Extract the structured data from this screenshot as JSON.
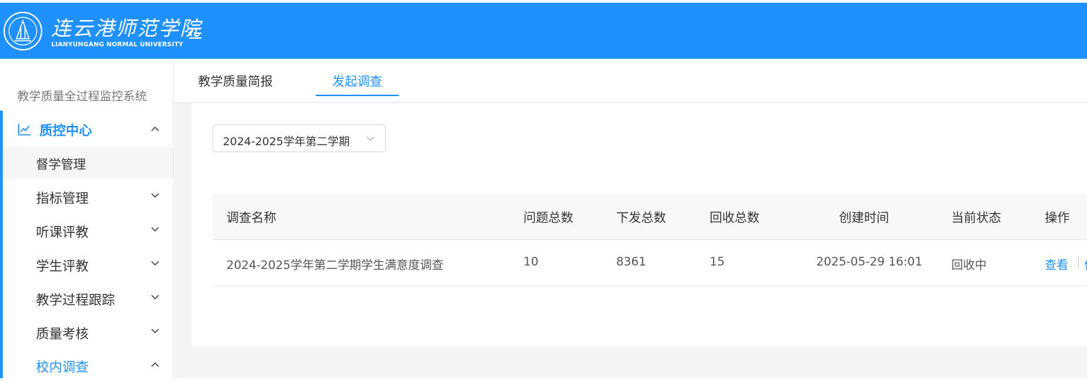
{
  "header": {
    "logo_name": "连云港师范学院",
    "logo_sub": "LIANYUNGANG NORMAL UNIVERSITY",
    "brand_color": "#1e90ff",
    "toggle_icon": "menu-fold-icon"
  },
  "sidebar": {
    "system_title": "教学质量全过程监控系统",
    "group_title": "质控中心",
    "group_icon": "line-chart-icon",
    "items": [
      {
        "label": "督学管理",
        "active": true
      },
      {
        "label": "指标管理"
      },
      {
        "label": "听课评教"
      },
      {
        "label": "学生评教"
      },
      {
        "label": "教学过程跟踪"
      },
      {
        "label": "质量考核"
      },
      {
        "label": "校内调查",
        "highlight": true
      }
    ]
  },
  "tabs": [
    {
      "label": "教学质量简报"
    },
    {
      "label": "发起调查",
      "active": true
    }
  ],
  "filter": {
    "semester_value": "2024-2025学年第二学期"
  },
  "table": {
    "columns": [
      "调查名称",
      "问题总数",
      "下发总数",
      "回收总数",
      "创建时间",
      "当前状态",
      "操作"
    ],
    "rows": [
      {
        "name": "2024-2025学年第二学期学生满意度调查",
        "questions": "10",
        "issued": "8361",
        "collected": "15",
        "created": "2025-05-29 16:01",
        "status": "回收中",
        "action_view": "查看",
        "action_more": "修"
      }
    ]
  }
}
